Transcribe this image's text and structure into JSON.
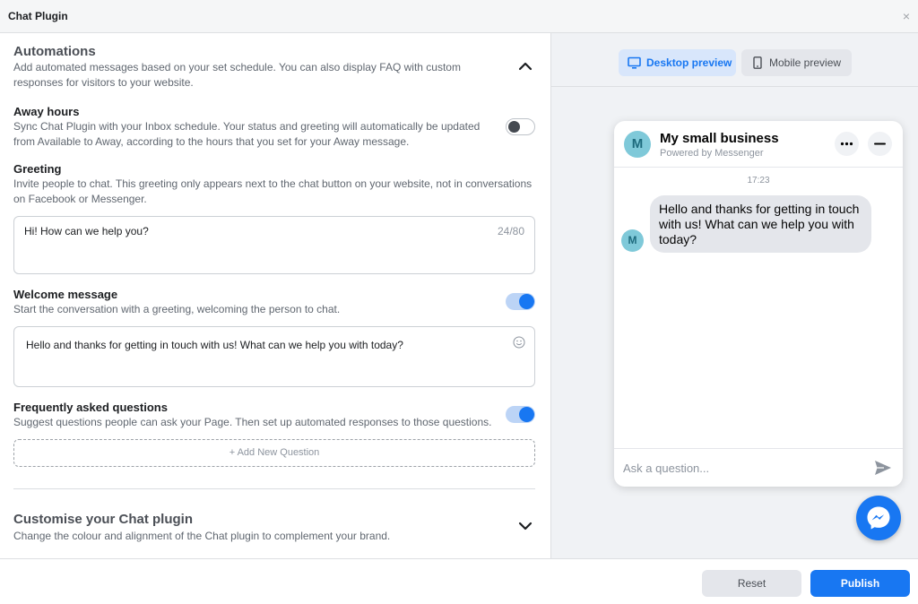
{
  "window": {
    "title": "Chat Plugin",
    "close_glyph": "×"
  },
  "automations": {
    "title": "Automations",
    "description": "Add automated messages based on your set schedule. You can also display FAQ with custom responses for visitors to your website.",
    "expanded": true,
    "away_hours": {
      "title": "Away hours",
      "description": "Sync Chat Plugin with your Inbox schedule. Your status and greeting will automatically be updated from Available to Away, according to the hours that you set for your Away message.",
      "enabled": false
    },
    "greeting": {
      "title": "Greeting",
      "description": "Invite people to chat. This greeting only appears next to the chat button on your website, not in conversations on Facebook or Messenger.",
      "value": "Hi! How can we help you?",
      "char_count": "24/80"
    },
    "welcome_message": {
      "title": "Welcome message",
      "description": "Start the conversation with a greeting, welcoming the person to chat.",
      "enabled": true,
      "value": "Hello and thanks for getting in touch with us! What can we help you with today?"
    },
    "faq": {
      "title": "Frequently asked questions",
      "description": "Suggest questions people can ask your Page. Then set up automated responses to those questions.",
      "enabled": true,
      "add_label": "+ Add New Question"
    }
  },
  "customise": {
    "title": "Customise your Chat plugin",
    "description": "Change the colour and alignment of the Chat plugin to complement your brand.",
    "expanded": false
  },
  "preview": {
    "desktop_label": "Desktop preview",
    "mobile_label": "Mobile preview",
    "active": "desktop",
    "chat": {
      "avatar_letter": "M",
      "business_name": "My small business",
      "powered_by": "Powered by Messenger",
      "time": "17:23",
      "message": "Hello and thanks for getting in touch with us! What can we help you with today?",
      "input_placeholder": "Ask a question..."
    }
  },
  "footer": {
    "reset_label": "Reset",
    "publish_label": "Publish"
  },
  "colors": {
    "accent": "#1877f2",
    "accent_light": "#d8e6fb",
    "panel_bg": "#f0f2f5",
    "avatar_bg": "#7fc9d9"
  },
  "icons": [
    "close-icon",
    "chevron-up-icon",
    "chevron-down-icon",
    "smiley-icon",
    "desktop-icon",
    "mobile-icon",
    "more-icon",
    "minimize-icon",
    "send-icon",
    "messenger-icon"
  ]
}
